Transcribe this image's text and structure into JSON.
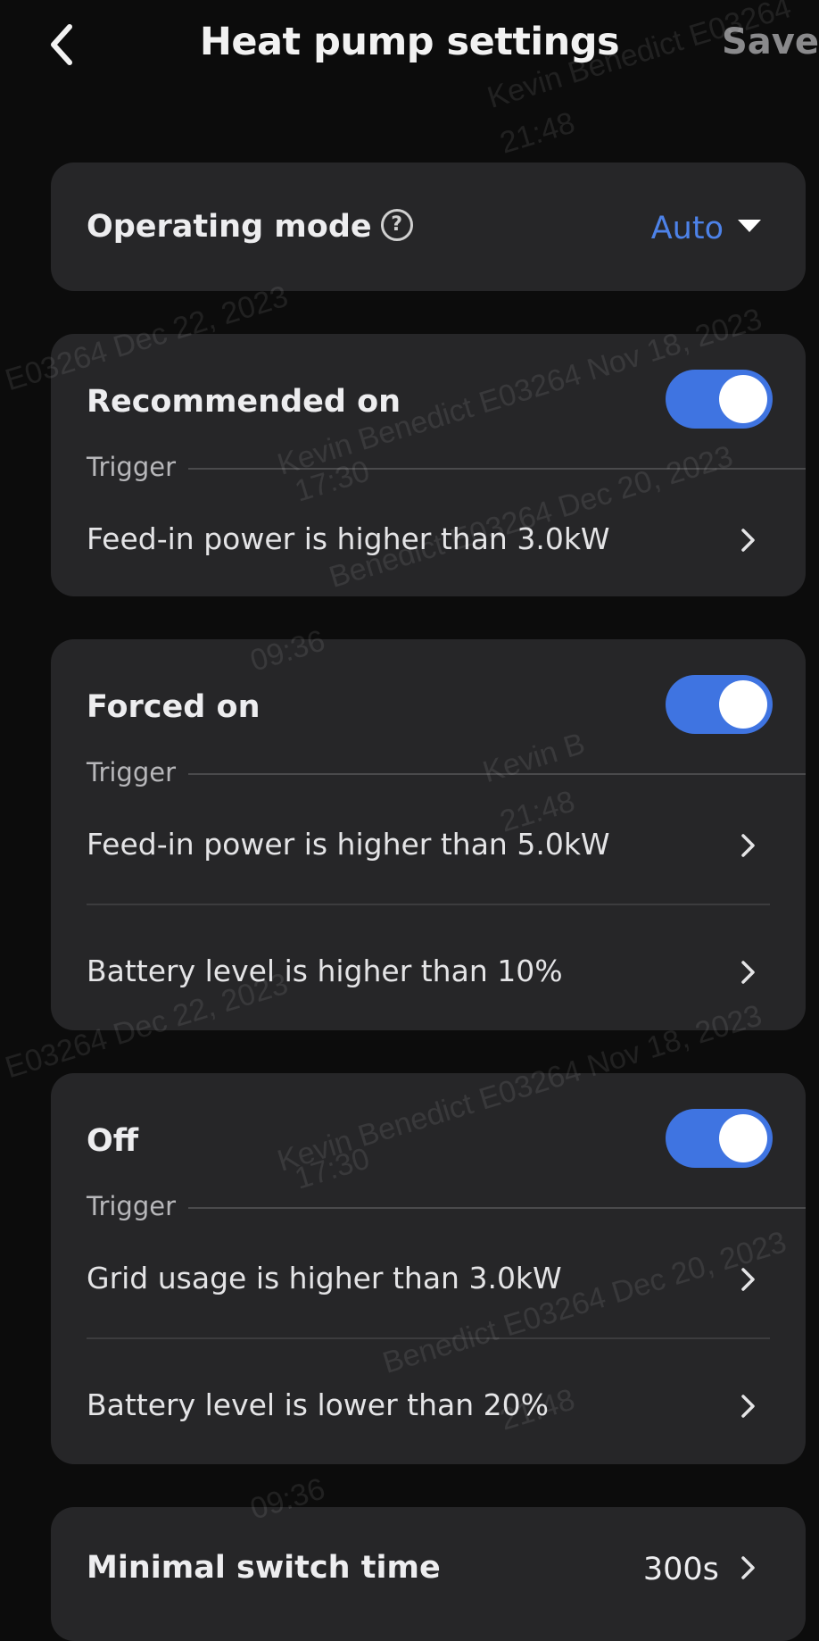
{
  "header": {
    "title": "Heat pump settings",
    "save_label": "Save",
    "back_icon": "chevron-left-icon"
  },
  "operating_mode": {
    "label": "Operating mode",
    "help_icon": "?",
    "value": "Auto",
    "accent": "#4d82e8"
  },
  "recommended_on": {
    "label": "Recommended on",
    "enabled": true,
    "trigger_label": "Trigger",
    "conditions": [
      "Feed-in power is higher than 3.0kW"
    ]
  },
  "forced_on": {
    "label": "Forced on",
    "enabled": true,
    "trigger_label": "Trigger",
    "conditions": [
      "Feed-in power is higher than 5.0kW",
      "Battery level is higher than 10%"
    ]
  },
  "off": {
    "label": "Off",
    "enabled": true,
    "trigger_label": "Trigger",
    "conditions": [
      "Grid usage is higher than 3.0kW",
      "Battery level is lower than 20%"
    ]
  },
  "minimal_switch": {
    "label": "Minimal switch time",
    "value": "300s"
  },
  "colors": {
    "toggle_on": "#3f74e1",
    "card": "#262628",
    "background": "#0c0c0c"
  },
  "watermarks": [
    "Kevin Benedict E03264",
    "21:48",
    "E03264 Dec 22, 2023",
    "Kevin Benedict E03264 Nov 18, 2023",
    "Benedict E03264 Dec 20, 2023",
    "17:30",
    "Kevin B",
    "09:36"
  ]
}
